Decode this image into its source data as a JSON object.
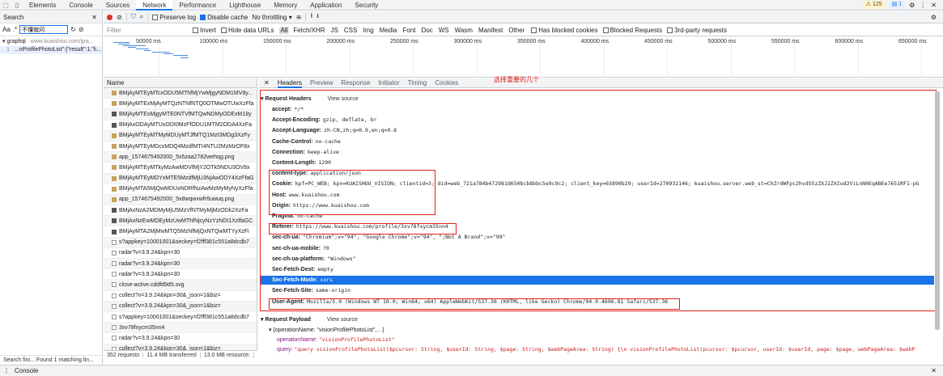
{
  "top_tabs": [
    "Elements",
    "Console",
    "Sources",
    "Network",
    "Performance",
    "Lighthouse",
    "Memory",
    "Application",
    "Security"
  ],
  "active_tab": "Network",
  "warnings_count": "125",
  "messages_count": "1",
  "search_panel": {
    "title": "Search",
    "aa_label": "Aa",
    "regex_label": ".*",
    "query": "不懂就问",
    "result_file": "graphql",
    "result_host": "www.kuaishou.com/gra...",
    "result_line_no": "1",
    "result_snippet": "...nProfilePhotoList\":{\"result\":1,\"li...",
    "status": "Search fini...  Found 1 matching lin..."
  },
  "network_toolbar": {
    "preserve_log": "Preserve log",
    "disable_cache": "Disable cache",
    "throttle": "No throttling"
  },
  "filter_bar": {
    "placeholder": "Filter",
    "invert": "Invert",
    "hide_data_urls": "Hide data URLs",
    "types": [
      "All",
      "Fetch/XHR",
      "JS",
      "CSS",
      "Img",
      "Media",
      "Font",
      "Doc",
      "WS",
      "Wasm",
      "Manifest",
      "Other"
    ],
    "blocked_cookies": "Has blocked cookies",
    "blocked_requests": "Blocked Requests",
    "third_party": "3rd-party requests"
  },
  "timeline_ticks": [
    "50000 ms",
    "100000 ms",
    "150000 ms",
    "200000 ms",
    "250000 ms",
    "300000 ms",
    "350000 ms",
    "400000 ms",
    "450000 ms",
    "500000 ms",
    "550000 ms",
    "600000 ms",
    "650000 ms"
  ],
  "name_header": "Name",
  "requests": [
    {
      "name": "BMjAyMTEyMTcxODU5MThfMjYwMjgyNDM1MV8y...",
      "icon": "img"
    },
    {
      "name": "BMjAyMTExMjAyMTQzNTNfNTQ0OTMwOTUwXzFfa",
      "icon": "img"
    },
    {
      "name": "BMjAyMTExMjgyMTE0NTVfMTQwNDMyODExM18y",
      "icon": "xhr"
    },
    {
      "name": "BMjAxODAyMTUxODI0MzFfODU1MTM2ODA4XzFa",
      "icon": "xhr"
    },
    {
      "name": "BMjAyMTEyMTMyMDUyMTJfMTQ1MzI3MDg3XzFy",
      "icon": "img"
    },
    {
      "name": "BMjAyMTEyMDcxMDQ4MzdfMTI4NTU2MzMzOF8x",
      "icon": "img"
    },
    {
      "name": "app_1574675492000_5x5zaa2782wehqg.png",
      "icon": "img"
    },
    {
      "name": "BMjAyMTEyMTkyMzAwMDVfMjY2OTk5NDU3OV8x",
      "icon": "img"
    },
    {
      "name": "BMjAyMTEyMDYxMTE5MzdfMjU3NjAwODY4XzFfaG",
      "icon": "img"
    },
    {
      "name": "BMjAyMTA5MjQwMDUxNDRfNzAwMzMyMyNyXzFfa",
      "icon": "img"
    },
    {
      "name": "app_1574675492000_5x8wqwxwfr6uwuq.png",
      "icon": "img"
    },
    {
      "name": "BMjAxNzA2MDMyMjU5MzVfNTMyMjMzODk2XzFa",
      "icon": "xhr"
    },
    {
      "name": "BMjAxNzEwMDEyMzUwMThfNjcyNzYzNDI1XzlfaGC",
      "icon": "xhr"
    },
    {
      "name": "BMjAyMTA2MjMwMTQ5MzNfMjQxNTQwMTYyXzFi",
      "icon": "xhr"
    },
    {
      "name": "s?appkey=10001001&seckey=f2fff381c551a8dcdb7",
      "icon": "doc"
    },
    {
      "name": "radar?v=3.9.24&kpn=30",
      "icon": "doc"
    },
    {
      "name": "radar?v=3.9.24&kpn=30",
      "icon": "doc"
    },
    {
      "name": "radar?v=3.9.24&kpn=30",
      "icon": "doc"
    },
    {
      "name": "close-active.cddfd9d5.svg",
      "icon": "doc"
    },
    {
      "name": "collect?v=3.9.24&kpn=30&_json=1&biz=",
      "icon": "doc"
    },
    {
      "name": "collect?v=3.9.24&kpn=30&_json=1&biz=",
      "icon": "doc"
    },
    {
      "name": "s?appkey=10001001&seckey=f2fff381c551a8dcdb7",
      "icon": "doc"
    },
    {
      "name": "3xv78fxycm35nn4",
      "icon": "doc"
    },
    {
      "name": "radar?v=3.9.24&kpn=30",
      "icon": "doc"
    },
    {
      "name": "collect?v=3.9.24&kpn=30&_json=1&biz=",
      "icon": "doc"
    }
  ],
  "net_status": {
    "requests": "352 requests",
    "transferred": "11.4 MB transferred",
    "resources": "13.0 MB resource:"
  },
  "detail_tabs": [
    "Headers",
    "Preview",
    "Response",
    "Initiator",
    "Timing",
    "Cookies"
  ],
  "annotation": "选择重要的几个",
  "request_headers_title": "Request Headers",
  "view_source": "View source",
  "headers": [
    {
      "k": "accept:",
      "v": "*/*"
    },
    {
      "k": "Accept-Encoding:",
      "v": "gzip, deflate, br"
    },
    {
      "k": "Accept-Language:",
      "v": "zh-CN,zh;q=0.9,en;q=0.8"
    },
    {
      "k": "Cache-Control:",
      "v": "no-cache"
    },
    {
      "k": "Connection:",
      "v": "keep-alive"
    },
    {
      "k": "Content-Length:",
      "v": "1290"
    },
    {
      "k": "content-type:",
      "v": "application/json"
    },
    {
      "k": "Cookie:",
      "v": "kpf=PC_WEB; kpn=KUAISHOU_VISION; clientid=3; did=web_721a784b472981d650bcb8bbc5e9c9c2; client_key=65890b29; userId=270932146; kuaishou.server.web_st=ChZrdWFpc2hvdS5zZXJ2ZXIud2ViLnN0EqABEe7651RF1-pG"
    },
    {
      "k": "Host:",
      "v": "www.kuaishou.com"
    },
    {
      "k": "Origin:",
      "v": "https://www.kuaishou.com"
    },
    {
      "k": "Pragma:",
      "v": "no-cache"
    },
    {
      "k": "Referer:",
      "v": "https://www.kuaishou.com/profile/3xv78fxycm35nn4"
    },
    {
      "k": "sec-ch-ua:",
      "v": "\"Chromium\";v=\"94\", \"Google Chrome\";v=\"94\", \";Not A Brand\";v=\"99\""
    },
    {
      "k": "sec-ch-ua-mobile:",
      "v": "?0"
    },
    {
      "k": "sec-ch-ua-platform:",
      "v": "\"Windows\""
    },
    {
      "k": "Sec-Fetch-Dest:",
      "v": "empty"
    },
    {
      "k": "Sec-Fetch-Mode:",
      "v": "cors"
    },
    {
      "k": "Sec-Fetch-Site:",
      "v": "same-origin"
    },
    {
      "k": "User-Agent:",
      "v": "Mozilla/5.0 (Windows NT 10.0; Win64; x64) AppleWebKit/537.36 (KHTML, like Gecko) Chrome/94.0.4606.81 Safari/537.36"
    }
  ],
  "payload_title": "Request Payload",
  "payload_root": "{operationName: \"visionProfilePhotoList\",…}",
  "payload_op_key": "operationName:",
  "payload_op_val": "\"visionProfilePhotoList\"",
  "payload_query_key": "query:",
  "payload_query_val": "\"query visionProfilePhotoList($pcursor: String, $userId: String, $page: String, $webPageArea: String) {\\n  visionProfilePhotoList(pcursor: $pcursor, userId: $userId, page: $page, webPageArea: $webP",
  "drawer_tab": "Console"
}
